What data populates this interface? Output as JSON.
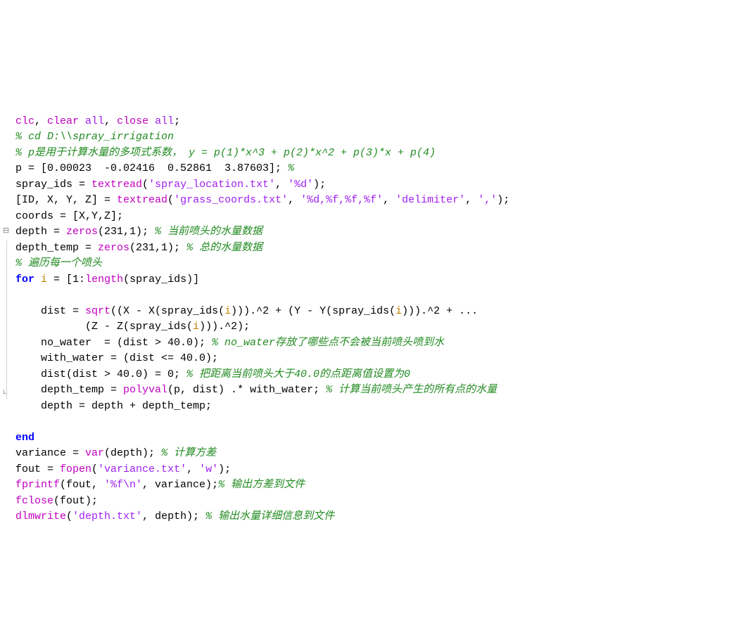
{
  "code": {
    "lines": [
      {
        "segments": [
          {
            "cls": "fn",
            "t": "clc"
          },
          {
            "cls": "",
            "t": ", "
          },
          {
            "cls": "fn",
            "t": "clear "
          },
          {
            "cls": "str",
            "t": "all"
          },
          {
            "cls": "",
            "t": ", "
          },
          {
            "cls": "fn",
            "t": "close "
          },
          {
            "cls": "str",
            "t": "all"
          },
          {
            "cls": "",
            "t": ";"
          }
        ]
      },
      {
        "segments": [
          {
            "cls": "cmt",
            "t": "% cd D:\\\\spray_irrigation"
          }
        ]
      },
      {
        "segments": [
          {
            "cls": "cmt",
            "t": "% p是用于计算水量的多项式系数， y = p(1)*x^3 + p(2)*x^2 + p(3)*x + p(4)"
          }
        ]
      },
      {
        "segments": [
          {
            "cls": "",
            "t": "p = [0.00023  -0.02416  0.52861  3.87603]; "
          },
          {
            "cls": "cmt",
            "t": "%"
          }
        ]
      },
      {
        "segments": [
          {
            "cls": "",
            "t": "spray_ids = "
          },
          {
            "cls": "fn",
            "t": "textread"
          },
          {
            "cls": "",
            "t": "("
          },
          {
            "cls": "str",
            "t": "'spray_location.txt'"
          },
          {
            "cls": "",
            "t": ", "
          },
          {
            "cls": "str",
            "t": "'%d'"
          },
          {
            "cls": "",
            "t": ");"
          }
        ]
      },
      {
        "segments": [
          {
            "cls": "",
            "t": "[ID, X, Y, Z] = "
          },
          {
            "cls": "fn",
            "t": "textread"
          },
          {
            "cls": "",
            "t": "("
          },
          {
            "cls": "str",
            "t": "'grass_coords.txt'"
          },
          {
            "cls": "",
            "t": ", "
          },
          {
            "cls": "str",
            "t": "'%d,%f,%f,%f'"
          },
          {
            "cls": "",
            "t": ", "
          },
          {
            "cls": "str",
            "t": "'delimiter'"
          },
          {
            "cls": "",
            "t": ", "
          },
          {
            "cls": "str",
            "t": "','"
          },
          {
            "cls": "",
            "t": ");"
          }
        ]
      },
      {
        "segments": [
          {
            "cls": "",
            "t": "coords = [X,Y,Z];"
          }
        ]
      },
      {
        "segments": [
          {
            "cls": "",
            "t": "depth = "
          },
          {
            "cls": "fn",
            "t": "zeros"
          },
          {
            "cls": "",
            "t": "(231,1); "
          },
          {
            "cls": "cmt",
            "t": "% 当前喷头的水量数据"
          }
        ]
      },
      {
        "segments": [
          {
            "cls": "",
            "t": "depth_temp = "
          },
          {
            "cls": "fn",
            "t": "zeros"
          },
          {
            "cls": "",
            "t": "(231,1); "
          },
          {
            "cls": "cmt",
            "t": "% 总的水量数据"
          }
        ]
      },
      {
        "segments": [
          {
            "cls": "cmt",
            "t": "% 遍历每一个喷头"
          }
        ]
      },
      {
        "segments": [
          {
            "cls": "kw",
            "t": "for"
          },
          {
            "cls": "",
            "t": " "
          },
          {
            "cls": "idx",
            "t": "i"
          },
          {
            "cls": "",
            "t": " = [1:"
          },
          {
            "cls": "fn",
            "t": "length"
          },
          {
            "cls": "",
            "t": "(spray_ids)]"
          }
        ]
      },
      {
        "segments": [
          {
            "cls": "",
            "t": "    "
          }
        ]
      },
      {
        "segments": [
          {
            "cls": "",
            "t": "    dist = "
          },
          {
            "cls": "fn",
            "t": "sqrt"
          },
          {
            "cls": "",
            "t": "((X - X(spray_ids("
          },
          {
            "cls": "idx",
            "t": "i"
          },
          {
            "cls": "",
            "t": "))).^2 + (Y - Y(spray_ids("
          },
          {
            "cls": "idx",
            "t": "i"
          },
          {
            "cls": "",
            "t": "))).^2 + ..."
          }
        ]
      },
      {
        "segments": [
          {
            "cls": "",
            "t": "           (Z - Z(spray_ids("
          },
          {
            "cls": "idx",
            "t": "i"
          },
          {
            "cls": "",
            "t": "))).^2);"
          }
        ]
      },
      {
        "segments": [
          {
            "cls": "",
            "t": "    no_water  = (dist > 40.0); "
          },
          {
            "cls": "cmt",
            "t": "% no_water存放了哪些点不会被当前喷头喷到水"
          }
        ]
      },
      {
        "segments": [
          {
            "cls": "",
            "t": "    with_water = (dist <= 40.0);"
          }
        ]
      },
      {
        "segments": [
          {
            "cls": "",
            "t": "    dist(dist > 40.0) = 0; "
          },
          {
            "cls": "cmt",
            "t": "% 把距离当前喷头大于40.0的点距离值设置为0"
          }
        ]
      },
      {
        "segments": [
          {
            "cls": "",
            "t": "    depth_temp = "
          },
          {
            "cls": "fn",
            "t": "polyval"
          },
          {
            "cls": "",
            "t": "(p, dist) .* with_water; "
          },
          {
            "cls": "cmt",
            "t": "% 计算当前喷头产生的所有点的水量"
          }
        ]
      },
      {
        "segments": [
          {
            "cls": "",
            "t": "    depth = depth + depth_temp;"
          }
        ]
      },
      {
        "segments": [
          {
            "cls": "",
            "t": "    "
          }
        ]
      },
      {
        "segments": [
          {
            "cls": "kw",
            "t": "end"
          }
        ]
      },
      {
        "segments": [
          {
            "cls": "",
            "t": "variance = "
          },
          {
            "cls": "fn",
            "t": "var"
          },
          {
            "cls": "",
            "t": "(depth); "
          },
          {
            "cls": "cmt",
            "t": "% 计算方差"
          }
        ]
      },
      {
        "segments": [
          {
            "cls": "",
            "t": "fout = "
          },
          {
            "cls": "fn",
            "t": "fopen"
          },
          {
            "cls": "",
            "t": "("
          },
          {
            "cls": "str",
            "t": "'variance.txt'"
          },
          {
            "cls": "",
            "t": ", "
          },
          {
            "cls": "str",
            "t": "'w'"
          },
          {
            "cls": "",
            "t": ");"
          }
        ]
      },
      {
        "segments": [
          {
            "cls": "fn",
            "t": "fprintf"
          },
          {
            "cls": "",
            "t": "(fout, "
          },
          {
            "cls": "str",
            "t": "'%f\\n'"
          },
          {
            "cls": "",
            "t": ", variance);"
          },
          {
            "cls": "cmt",
            "t": "% 输出方差到文件"
          }
        ]
      },
      {
        "segments": [
          {
            "cls": "fn",
            "t": "fclose"
          },
          {
            "cls": "",
            "t": "(fout);"
          }
        ]
      },
      {
        "segments": [
          {
            "cls": "fn",
            "t": "dlmwrite"
          },
          {
            "cls": "",
            "t": "("
          },
          {
            "cls": "str",
            "t": "'depth.txt'"
          },
          {
            "cls": "",
            "t": ", depth); "
          },
          {
            "cls": "cmt",
            "t": "% 输出水量详细信息到文件"
          }
        ]
      }
    ],
    "fold": {
      "start": 10,
      "end": 20
    }
  }
}
